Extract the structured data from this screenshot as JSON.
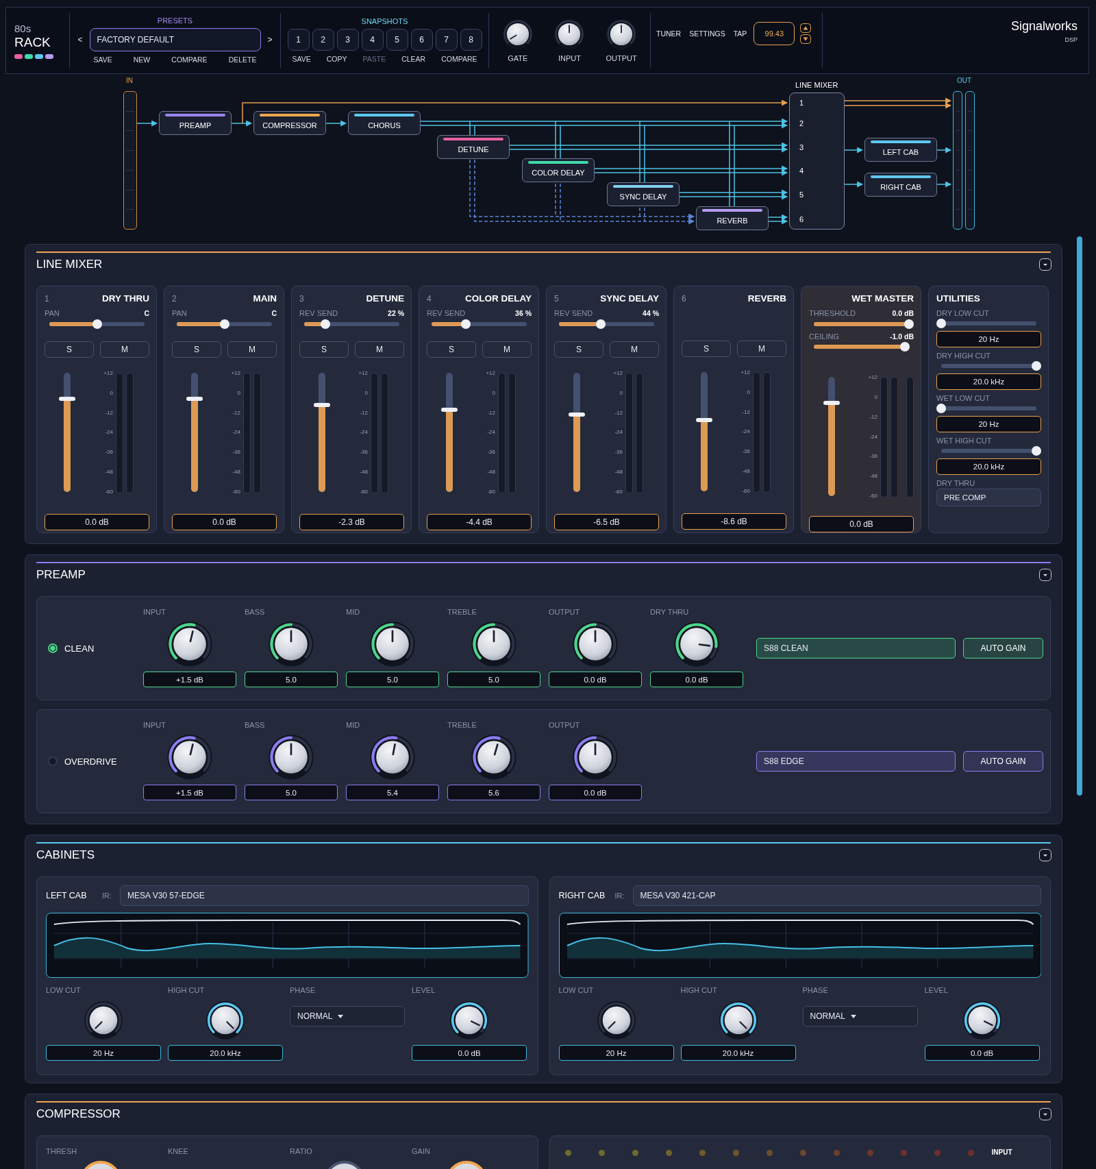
{
  "header": {
    "brand_top": "80s",
    "brand": "RACK",
    "swatches": [
      {
        "color": "#e8619e"
      },
      {
        "color": "#3fd9a8"
      },
      {
        "color": "#5cc8ef"
      },
      {
        "color": "#b49df2"
      }
    ],
    "presets": {
      "title": "PRESETS",
      "prev": "<",
      "value": "FACTORY DEFAULT",
      "next": ">",
      "actions": [
        "SAVE",
        "NEW",
        "COMPARE",
        "DELETE"
      ]
    },
    "snapshots": {
      "title": "SNAPSHOTS",
      "slots": [
        "1",
        "2",
        "3",
        "4",
        "5",
        "6",
        "7",
        "8"
      ],
      "actions": [
        {
          "label": "SAVE",
          "disabled": false
        },
        {
          "label": "COPY",
          "disabled": false
        },
        {
          "label": "PASTE",
          "disabled": true
        },
        {
          "label": "CLEAR",
          "disabled": false
        },
        {
          "label": "COMPARE",
          "disabled": false
        }
      ]
    },
    "knobs": [
      {
        "label": "GATE"
      },
      {
        "label": "INPUT"
      },
      {
        "label": "OUTPUT"
      }
    ],
    "links": [
      "TUNER",
      "SETTINGS",
      "TAP"
    ],
    "tempo": "99.43",
    "maker": "Signalworks",
    "maker_sub": "DSP"
  },
  "signal_flow": {
    "in_label": "IN",
    "out_label": "OUT",
    "mixer": {
      "title": "LINE MIXER",
      "inputs": [
        "1",
        "2",
        "3",
        "4",
        "5",
        "6"
      ]
    },
    "nodes": [
      {
        "label": "PREAMP",
        "color": "#9b86f2"
      },
      {
        "label": "COMPRESSOR",
        "color": "#f0a650"
      },
      {
        "label": "CHORUS",
        "color": "#5cc8ef"
      },
      {
        "label": "DETUNE",
        "color": "#e8619e"
      },
      {
        "label": "COLOR DELAY",
        "color": "#3fd9a8"
      },
      {
        "label": "SYNC DELAY",
        "color": "#7fd0f0"
      },
      {
        "label": "REVERB",
        "color": "#b49df2"
      },
      {
        "label": "LEFT CAB",
        "color": "#5cc8ef"
      },
      {
        "label": "RIGHT CAB",
        "color": "#5cc8ef"
      }
    ]
  },
  "line_mixer": {
    "title": "LINE MIXER",
    "color": "#f0a650",
    "strips": [
      {
        "kind": "channel",
        "number": "1",
        "name": "DRY THRU",
        "param": {
          "label": "PAN",
          "value": "C",
          "level": 0.5
        },
        "solo": "S",
        "mute": "M",
        "fader": {
          "level": 0.78
        },
        "scale": [
          "+12",
          "0",
          "-12",
          "-24",
          "-36",
          "-48",
          "-60"
        ],
        "value": "0.0 dB"
      },
      {
        "kind": "channel",
        "number": "2",
        "name": "MAIN",
        "param": {
          "label": "PAN",
          "value": "C",
          "level": 0.5
        },
        "solo": "S",
        "mute": "M",
        "fader": {
          "level": 0.78
        },
        "scale": [
          "+12",
          "0",
          "-12",
          "-24",
          "-36",
          "-48",
          "-60"
        ],
        "value": "0.0 dB"
      },
      {
        "kind": "channel",
        "number": "3",
        "name": "DETUNE",
        "param": {
          "label": "REV SEND",
          "value": "22 %",
          "level": 0.22
        },
        "solo": "S",
        "mute": "M",
        "fader": {
          "level": 0.73
        },
        "scale": [
          "+12",
          "0",
          "-12",
          "-24",
          "-36",
          "-48",
          "-60"
        ],
        "value": "-2.3 dB"
      },
      {
        "kind": "channel",
        "number": "4",
        "name": "COLOR DELAY",
        "param": {
          "label": "REV SEND",
          "value": "36 %",
          "level": 0.36
        },
        "solo": "S",
        "mute": "M",
        "fader": {
          "level": 0.69
        },
        "scale": [
          "+12",
          "0",
          "-12",
          "-24",
          "-36",
          "-48",
          "-60"
        ],
        "value": "-4.4 dB"
      },
      {
        "kind": "channel",
        "number": "5",
        "name": "SYNC DELAY",
        "param": {
          "label": "REV SEND",
          "value": "44 %",
          "level": 0.44
        },
        "solo": "S",
        "mute": "M",
        "fader": {
          "level": 0.65
        },
        "scale": [
          "+12",
          "0",
          "-12",
          "-24",
          "-36",
          "-48",
          "-60"
        ],
        "value": "-6.5 dB"
      },
      {
        "kind": "channel",
        "number": "6",
        "name": "REVERB",
        "solo": "S",
        "mute": "M",
        "fader": {
          "level": 0.6
        },
        "scale": [
          "+12",
          "0",
          "-12",
          "-24",
          "-36",
          "-48",
          "-60"
        ],
        "value": "-8.6 dB"
      },
      {
        "kind": "master",
        "name": "WET MASTER",
        "params": [
          {
            "label": "THRESHOLD",
            "value": "0.0 dB",
            "level": 1.0
          },
          {
            "label": "CEILING",
            "value": "-1.0 dB",
            "level": 0.96
          }
        ],
        "fader": {
          "level": 0.78
        },
        "scale": [
          "+12",
          "0",
          "-12",
          "-24",
          "-36",
          "-48",
          "-60"
        ],
        "value": "0.0 dB"
      },
      {
        "kind": "utilities",
        "name": "UTILITIES",
        "controls": [
          {
            "label": "DRY LOW CUT",
            "level": 0.0,
            "value": "20 Hz"
          },
          {
            "label": "DRY HIGH CUT",
            "level": 1.0,
            "value": "20.0 kHz"
          },
          {
            "label": "WET LOW CUT",
            "level": 0.0,
            "value": "20 Hz"
          },
          {
            "label": "WET HIGH CUT",
            "level": 1.0,
            "value": "20.0 kHz"
          }
        ],
        "select": {
          "label": "DRY THRU",
          "value": "PRE COMP"
        }
      }
    ]
  },
  "preamp": {
    "title": "PREAMP",
    "color": "#8c7cf0",
    "channels": [
      {
        "name": "CLEAN",
        "selected": true,
        "color": "#4cd68a",
        "knobs": [
          {
            "label": "INPUT",
            "value": "+1.5 dB"
          },
          {
            "label": "BASS",
            "value": "5.0"
          },
          {
            "label": "MID",
            "value": "5.0"
          },
          {
            "label": "TREBLE",
            "value": "5.0"
          },
          {
            "label": "OUTPUT",
            "value": "0.0 dB"
          },
          {
            "label": "DRY THRU",
            "value": "0.0 dB"
          }
        ],
        "model": "S88 CLEAN",
        "auto_gain": "AUTO GAIN"
      },
      {
        "name": "OVERDRIVE",
        "selected": false,
        "color": "#8c7cf0",
        "knobs": [
          {
            "label": "INPUT",
            "value": "+1.5 dB"
          },
          {
            "label": "BASS",
            "value": "5.0"
          },
          {
            "label": "MID",
            "value": "5.4"
          },
          {
            "label": "TREBLE",
            "value": "5.6"
          },
          {
            "label": "OUTPUT",
            "value": "0.0 dB"
          }
        ],
        "model": "S88 EDGE",
        "auto_gain": "AUTO GAIN"
      }
    ]
  },
  "cabinets": {
    "title": "CABINETS",
    "color": "#5cc8ef",
    "cabs": [
      {
        "name": "LEFT CAB",
        "ir_label": "IR:",
        "ir": "MESA V30 57-EDGE",
        "controls": [
          {
            "kind": "knob",
            "label": "LOW CUT",
            "value": "20 Hz"
          },
          {
            "kind": "knob",
            "label": "HIGH CUT",
            "value": "20.0 kHz"
          },
          {
            "kind": "select",
            "label": "PHASE",
            "value": "NORMAL"
          },
          {
            "kind": "knob",
            "label": "LEVEL",
            "value": "0.0 dB"
          }
        ]
      },
      {
        "name": "RIGHT CAB",
        "ir_label": "IR:",
        "ir": "MESA V30 421-CAP",
        "controls": [
          {
            "kind": "knob",
            "label": "LOW CUT",
            "value": "20 Hz"
          },
          {
            "kind": "knob",
            "label": "HIGH CUT",
            "value": "20.0 kHz"
          },
          {
            "kind": "select",
            "label": "PHASE",
            "value": "NORMAL"
          },
          {
            "kind": "knob",
            "label": "LEVEL",
            "value": "0.0 dB"
          }
        ]
      }
    ]
  },
  "compressor": {
    "title": "COMPRESSOR",
    "color": "#f0a650",
    "knobs": [
      {
        "label": "THRESH",
        "color": "#f0a650"
      },
      {
        "label": "KNEE"
      },
      {
        "label": "RATIO",
        "color": "#4a5370"
      },
      {
        "label": "GAIN",
        "color": "#f0a650"
      }
    ],
    "meter": {
      "label": "INPUT",
      "leds": [
        {
          "color": "#6e6a2e"
        },
        {
          "color": "#6e6a2e"
        },
        {
          "color": "#6e6a2e"
        },
        {
          "color": "#6e642e"
        },
        {
          "color": "#6e5c2e"
        },
        {
          "color": "#6e562e"
        },
        {
          "color": "#6e4e2e"
        },
        {
          "color": "#6e462e"
        },
        {
          "color": "#6e3e2e"
        },
        {
          "color": "#6e362e"
        },
        {
          "color": "#6e302e"
        },
        {
          "color": "#6e2e2e"
        },
        {
          "color": "#6e2e2e"
        }
      ]
    }
  }
}
